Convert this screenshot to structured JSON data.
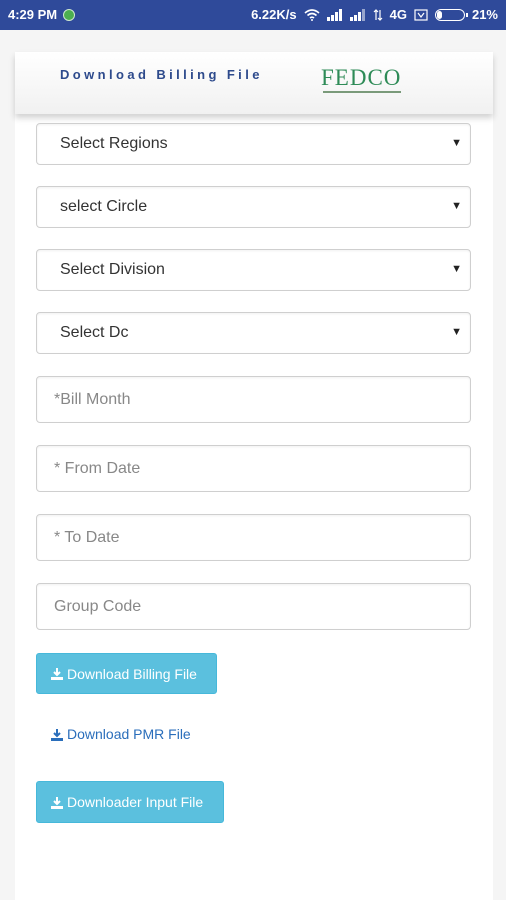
{
  "status_bar": {
    "time": "4:29 PM",
    "speed": "6.22K/s",
    "network": "4G",
    "battery": "21%",
    "battery_level": 0.21
  },
  "header": {
    "title": "Download Billing File",
    "logo": "FEDCO"
  },
  "form": {
    "regions": "Select Regions",
    "circle": "select Circle",
    "division": "Select Division",
    "dc": "Select Dc",
    "bill_month_placeholder": "*Bill Month",
    "from_date_placeholder": "* From Date",
    "to_date_placeholder": "* To Date",
    "group_code_placeholder": "Group Code"
  },
  "actions": {
    "download_billing": "Download Billing File",
    "download_pmr": "Download PMR File",
    "downloader_input": "Downloader Input File"
  },
  "colors": {
    "status_bar": "#2f4a9a",
    "title": "#2d4a8c",
    "button": "#5bc0de",
    "link": "#2a6ebb",
    "logo": "#2e8b57"
  }
}
